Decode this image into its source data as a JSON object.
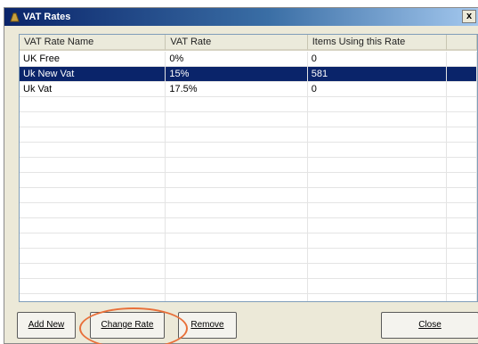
{
  "window": {
    "title": "VAT Rates",
    "close_glyph": "x"
  },
  "table": {
    "columns": [
      "VAT Rate Name",
      "VAT Rate",
      "Items Using this Rate",
      ""
    ],
    "rows": [
      [
        "UK Free",
        "0%",
        "0",
        ""
      ],
      [
        "Uk New Vat",
        "15%",
        "581",
        ""
      ],
      [
        "Uk Vat",
        "17.5%",
        "0",
        ""
      ],
      [
        "",
        "",
        "",
        ""
      ],
      [
        "",
        "",
        "",
        ""
      ],
      [
        "",
        "",
        "",
        ""
      ],
      [
        "",
        "",
        "",
        ""
      ],
      [
        "",
        "",
        "",
        ""
      ],
      [
        "",
        "",
        "",
        ""
      ],
      [
        "",
        "",
        "",
        ""
      ],
      [
        "",
        "",
        "",
        ""
      ],
      [
        "",
        "",
        "",
        ""
      ],
      [
        "",
        "",
        "",
        ""
      ],
      [
        "",
        "",
        "",
        ""
      ],
      [
        "",
        "",
        "",
        ""
      ],
      [
        "",
        "",
        "",
        ""
      ],
      [
        "",
        "",
        "",
        ""
      ]
    ],
    "selected_row": 1
  },
  "buttons": {
    "add_new": "Add New",
    "change_rate": "Change Rate",
    "remove": "Remove",
    "close": "Close"
  },
  "colors": {
    "selection": "#0a246a",
    "annotation": "#e8703a"
  }
}
